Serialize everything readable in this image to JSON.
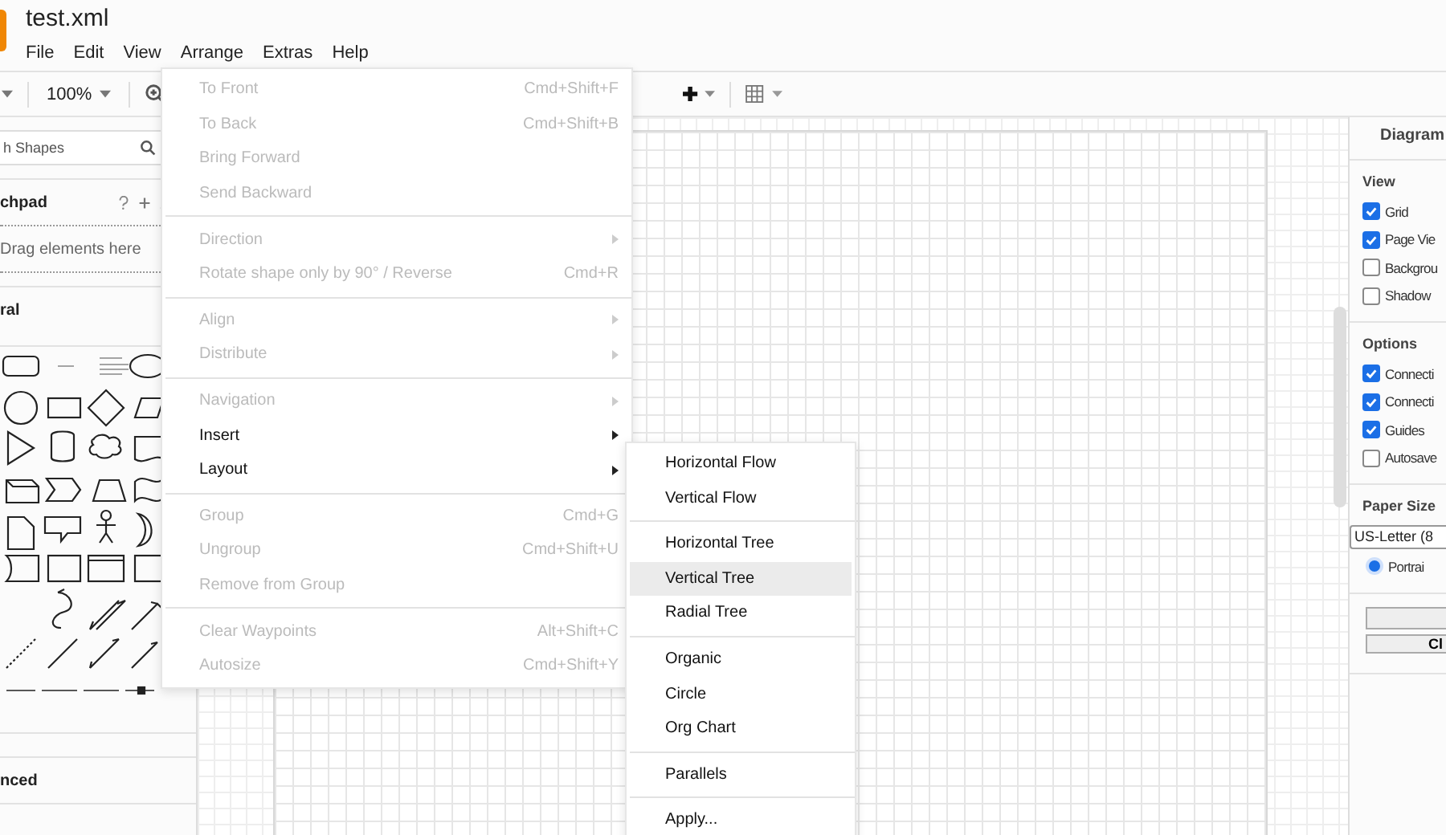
{
  "document": {
    "title": "test.xml"
  },
  "menu_bar": [
    "File",
    "Edit",
    "View",
    "Arrange",
    "Extras",
    "Help"
  ],
  "toolbar": {
    "zoom": "100%"
  },
  "sidebar": {
    "search": {
      "placeholder": "h Shapes"
    },
    "scratchpad": {
      "title": "chpad",
      "hint": "Drag elements here"
    },
    "sections": [
      "ral",
      "nced"
    ]
  },
  "arrange_menu": {
    "groups": [
      {
        "items": [
          {
            "label": "To Front",
            "shortcut": "Cmd+Shift+F",
            "submenu": false,
            "disabled": true
          },
          {
            "label": "To Back",
            "shortcut": "Cmd+Shift+B",
            "submenu": false,
            "disabled": true
          },
          {
            "label": "Bring Forward",
            "submenu": false,
            "disabled": true
          },
          {
            "label": "Send Backward",
            "submenu": false,
            "disabled": true
          }
        ]
      },
      {
        "items": [
          {
            "label": "Direction",
            "submenu": true,
            "disabled": true
          },
          {
            "label": "Rotate shape only by 90° / Reverse",
            "shortcut": "Cmd+R",
            "submenu": false,
            "disabled": true
          }
        ]
      },
      {
        "items": [
          {
            "label": "Align",
            "submenu": true,
            "disabled": true
          },
          {
            "label": "Distribute",
            "submenu": true,
            "disabled": true
          }
        ]
      },
      {
        "items": [
          {
            "label": "Navigation",
            "submenu": true,
            "disabled": true
          },
          {
            "label": "Insert",
            "submenu": true,
            "disabled": false
          },
          {
            "label": "Layout",
            "submenu": true,
            "disabled": false
          }
        ]
      },
      {
        "items": [
          {
            "label": "Group",
            "shortcut": "Cmd+G",
            "submenu": false,
            "disabled": true
          },
          {
            "label": "Ungroup",
            "shortcut": "Cmd+Shift+U",
            "submenu": false,
            "disabled": true
          },
          {
            "label": "Remove from Group",
            "submenu": false,
            "disabled": true
          }
        ]
      },
      {
        "items": [
          {
            "label": "Clear Waypoints",
            "shortcut": "Alt+Shift+C",
            "submenu": false,
            "disabled": true
          },
          {
            "label": "Autosize",
            "shortcut": "Cmd+Shift+Y",
            "submenu": false,
            "disabled": true
          }
        ]
      }
    ]
  },
  "layout_submenu": {
    "groups": [
      {
        "items": [
          {
            "label": "Horizontal Flow",
            "selected": false
          },
          {
            "label": "Vertical Flow",
            "selected": false
          }
        ]
      },
      {
        "items": [
          {
            "label": "Horizontal Tree",
            "selected": false
          },
          {
            "label": "Vertical Tree",
            "selected": true
          },
          {
            "label": "Radial Tree",
            "selected": false
          }
        ]
      },
      {
        "items": [
          {
            "label": "Organic",
            "selected": false
          },
          {
            "label": "Circle",
            "selected": false
          },
          {
            "label": "Org Chart",
            "selected": false
          }
        ]
      },
      {
        "items": [
          {
            "label": "Parallels",
            "selected": false
          }
        ]
      },
      {
        "items": [
          {
            "label": "Apply...",
            "selected": false
          }
        ]
      }
    ]
  },
  "format_panel": {
    "tab": "Diagram",
    "sections": [
      {
        "title": "View",
        "options": [
          {
            "label": "Grid",
            "checked": true
          },
          {
            "label": "Page Vie",
            "checked": true
          },
          {
            "label": "Backgrou",
            "checked": false
          },
          {
            "label": "Shadow",
            "checked": false
          }
        ]
      },
      {
        "title": "Options",
        "options": [
          {
            "label": "Connecti",
            "checked": true
          },
          {
            "label": "Connecti",
            "checked": true
          },
          {
            "label": "Guides",
            "checked": true
          },
          {
            "label": "Autosave",
            "checked": false
          }
        ]
      }
    ],
    "paper_size": {
      "title": "Paper Size",
      "value": "US-Letter (8",
      "orientation": {
        "label": "Portrai",
        "selected": true
      }
    },
    "buttons": [
      "Cl"
    ]
  }
}
